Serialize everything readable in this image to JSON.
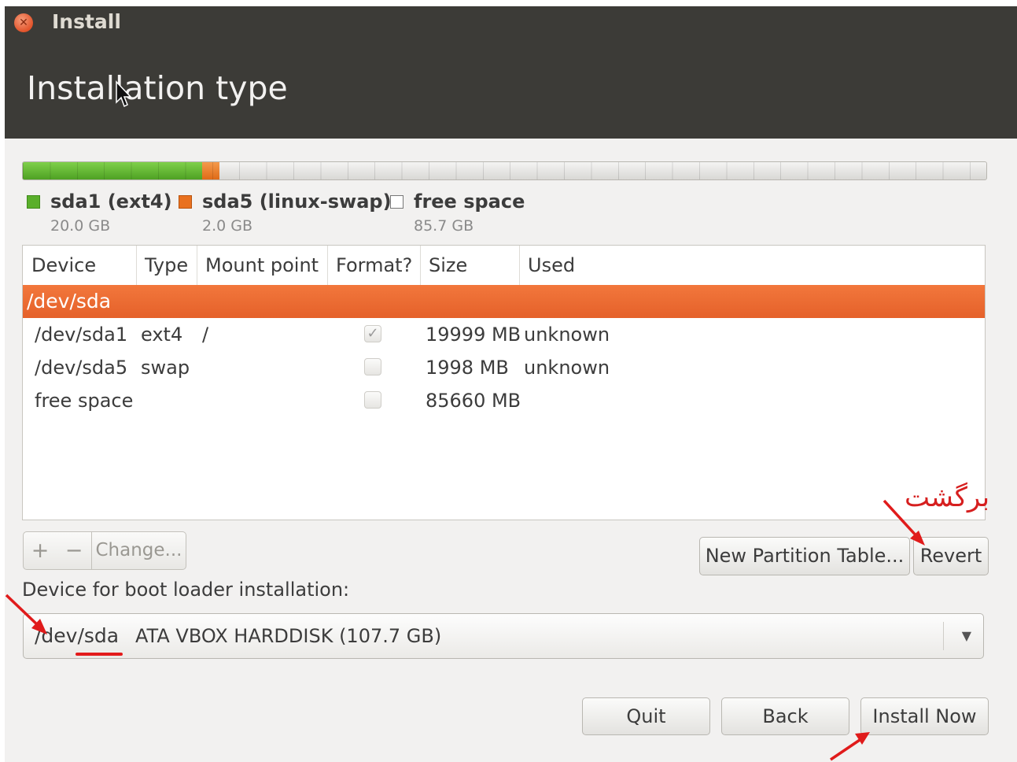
{
  "window": {
    "title": "Install",
    "page_title": "Installation type"
  },
  "partition_bar": {
    "segments": [
      {
        "name": "sda1 (ext4)",
        "size": "20.0 GB",
        "color": "#5aaf2b"
      },
      {
        "name": "sda5 (linux-swap)",
        "size": "2.0 GB",
        "color": "#e9711f"
      },
      {
        "name": "free space",
        "size": "85.7 GB",
        "color": "#ffffff"
      }
    ]
  },
  "table": {
    "columns": [
      "Device",
      "Type",
      "Mount point",
      "Format?",
      "Size",
      "Used"
    ],
    "disk": "/dev/sda",
    "rows": [
      {
        "device": "/dev/sda1",
        "type": "ext4",
        "mount": "/",
        "format": true,
        "size": "19999 MB",
        "used": "unknown"
      },
      {
        "device": "/dev/sda5",
        "type": "swap",
        "mount": "",
        "format": false,
        "size": "1998 MB",
        "used": "unknown"
      },
      {
        "device": "free space",
        "type": "",
        "mount": "",
        "format": false,
        "size": "85660 MB",
        "used": ""
      }
    ]
  },
  "toolbar": {
    "add_label": "+",
    "remove_label": "−",
    "change_label": "Change..."
  },
  "actions": {
    "new_table_label": "New Partition Table...",
    "revert_label": "Revert"
  },
  "boot": {
    "label": "Device for boot loader installation:",
    "device": "/dev/sda",
    "description": "ATA VBOX HARDDISK (107.7 GB)"
  },
  "footer": {
    "quit_label": "Quit",
    "back_label": "Back",
    "install_label": "Install Now"
  },
  "annotation": {
    "text": "برگشت",
    "color": "#d61f1f"
  }
}
